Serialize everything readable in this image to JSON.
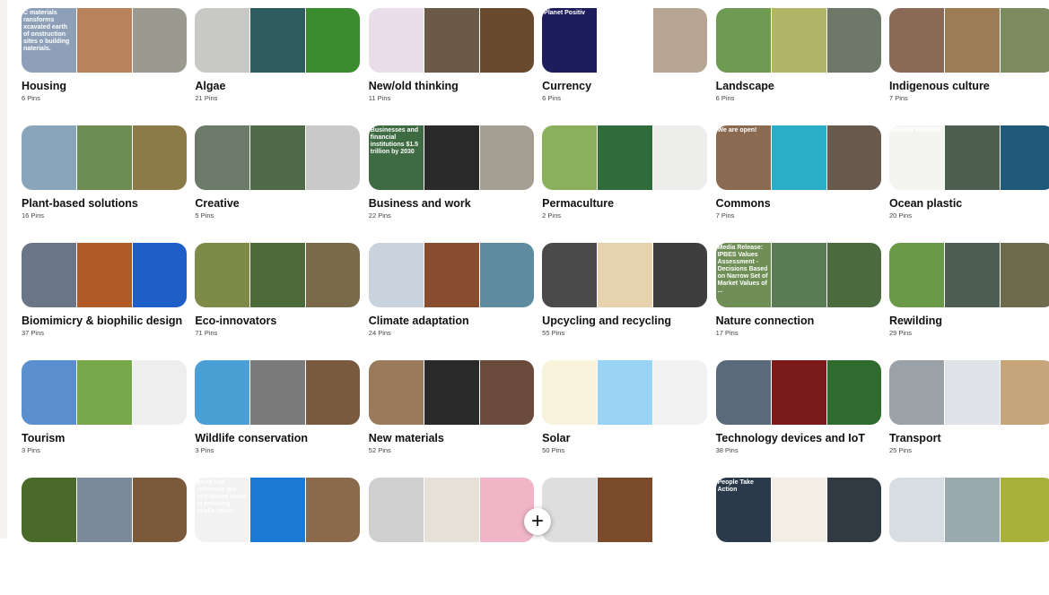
{
  "boards": [
    {
      "title": "Housing",
      "pins": "6 Pins",
      "colors": [
        "#8da0b8",
        "#b7835d",
        "#9a9a90"
      ],
      "overlay": "C materials ransforms xcavated earth of onstruction sites o building naterials."
    },
    {
      "title": "Algae",
      "pins": "21 Pins",
      "colors": [
        "#c8c8c4",
        "#2f5c5f",
        "#3a8c2f"
      ]
    },
    {
      "title": "New/old thinking",
      "pins": "11 Pins",
      "colors": [
        "#e9ddea",
        "#6b5a48",
        "#6a4a2e"
      ]
    },
    {
      "title": "Currency",
      "pins": "6 Pins",
      "colors": [
        "#1d1d5e",
        "#ffffff",
        "#b5a592"
      ],
      "overlay": "Planet Positiv"
    },
    {
      "title": "Landscape",
      "pins": "6 Pins",
      "colors": [
        "#6f9a53",
        "#b1b56a",
        "#6e7868"
      ]
    },
    {
      "title": "Indigenous culture",
      "pins": "7 Pins",
      "colors": [
        "#8a6a57",
        "#9c7c54",
        "#7c8a5f"
      ]
    },
    {
      "title": "Plant-based solutions",
      "pins": "16 Pins",
      "colors": [
        "#8aa4b9",
        "#6c8e55",
        "#8c7a48"
      ]
    },
    {
      "title": "Creative",
      "pins": "5 Pins",
      "colors": [
        "#6b7a69",
        "#4f6a46",
        "#c9c9c9"
      ]
    },
    {
      "title": "Business and work",
      "pins": "22 Pins",
      "colors": [
        "#3f6b43",
        "#2a2a2a",
        "#a59e93"
      ],
      "overlay": "Businesses and financial institutions $1.5 trillion by 2030"
    },
    {
      "title": "Permaculture",
      "pins": "2 Pins",
      "colors": [
        "#8ab05e",
        "#2f6b3b",
        "#ededeb"
      ]
    },
    {
      "title": "Commons",
      "pins": "7 Pins",
      "colors": [
        "#8b6a52",
        "#2aaec7",
        "#6a5a4d"
      ],
      "overlay": "We are open!"
    },
    {
      "title": "Ocean plastic",
      "pins": "20 Pins",
      "colors": [
        "#f4f4f0",
        "#4f5f4f",
        "#1f5a7a"
      ],
      "overlay": "GREEN WORMS"
    },
    {
      "title": "Biomimicry & biophilic design",
      "pins": "37 Pins",
      "colors": [
        "#6a7686",
        "#b05a27",
        "#1d5fc7"
      ]
    },
    {
      "title": "Eco-innovators",
      "pins": "71 Pins",
      "colors": [
        "#7d8a48",
        "#4c6a3a",
        "#7a6a4a"
      ]
    },
    {
      "title": "Climate adaptation",
      "pins": "24 Pins",
      "colors": [
        "#c9d3dd",
        "#8a4c2f",
        "#5e8ba0"
      ]
    },
    {
      "title": "Upcycling and recycling",
      "pins": "55 Pins",
      "colors": [
        "#4a4a4a",
        "#e7d2b0",
        "#3e3e3e"
      ]
    },
    {
      "title": "Nature connection",
      "pins": "17 Pins",
      "colors": [
        "#6f8f56",
        "#5a7c54",
        "#4b6a3d"
      ],
      "overlay": "Media Release: IPBES Values Assessment - Decisions Based on Narrow Set of Market Values of ..."
    },
    {
      "title": "Rewilding",
      "pins": "29 Pins",
      "colors": [
        "#6a9a48",
        "#4e5e52",
        "#6d6a4d"
      ]
    },
    {
      "title": "Tourism",
      "pins": "3 Pins",
      "colors": [
        "#5a8fcf",
        "#77a84a",
        "#eeeeee"
      ]
    },
    {
      "title": "Wildlife conservation",
      "pins": "3 Pins",
      "colors": [
        "#4aa0d4",
        "#7a7a7a",
        "#7a5a3f"
      ]
    },
    {
      "title": "New materials",
      "pins": "52 Pins",
      "colors": [
        "#9a7a5a",
        "#2a2a2a",
        "#6a4a3a"
      ]
    },
    {
      "title": "Solar",
      "pins": "50 Pins",
      "colors": [
        "#f7f2d9",
        "#9ad4f5",
        "#f1f1f1"
      ]
    },
    {
      "title": "Technology devices and IoT",
      "pins": "38 Pins",
      "colors": [
        "#5a6a7a",
        "#7a1a1a",
        "#2f6a2f"
      ]
    },
    {
      "title": "Transport",
      "pins": "25 Pins",
      "colors": [
        "#9aa1a7",
        "#dfe3e7",
        "#c6a57a"
      ]
    },
    {
      "title": "",
      "pins": "",
      "colors": [
        "#4a6a2a",
        "#7a8a9a",
        "#7a5a3a"
      ]
    },
    {
      "title": "",
      "pins": "",
      "colors": [
        "#f2f2f2",
        "#1a7ad4",
        "#8a6a4a"
      ],
      "overlay": "aring ical reference gui nity-based soluti st pressing challe cities."
    },
    {
      "title": "",
      "pins": "",
      "colors": [
        "#cfcfcf",
        "#e7e0d6",
        "#f0b6c8"
      ]
    },
    {
      "title": "",
      "pins": "",
      "colors": [
        "#dedede",
        "#7a4a2a",
        "#ffffff"
      ]
    },
    {
      "title": "",
      "pins": "",
      "colors": [
        "#2a3a4a",
        "#f2eee6",
        "#2f3a42"
      ],
      "overlay": "People Take Action"
    },
    {
      "title": "",
      "pins": "",
      "colors": [
        "#d6dde3",
        "#9aa9b0",
        "#a8b23a"
      ]
    }
  ],
  "fab": {
    "label": "+"
  }
}
